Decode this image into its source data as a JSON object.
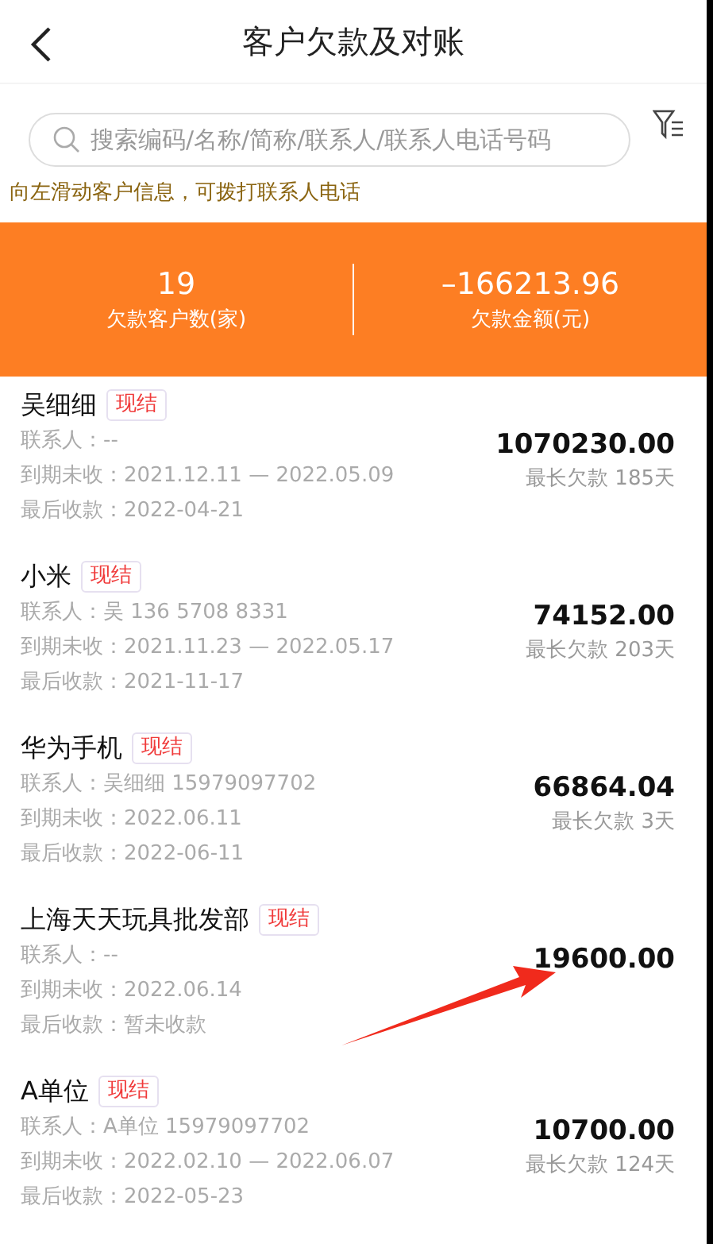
{
  "header": {
    "title": "客户欠款及对账"
  },
  "search": {
    "placeholder": "搜索编码/名称/简称/联系人/联系人电话号码"
  },
  "hint": "向左滑动客户信息，可拨打联系人电话",
  "summary": [
    {
      "value": "19",
      "label": "欠款客户数(家)"
    },
    {
      "value": "–166213.96",
      "label": "欠款金额(元)"
    }
  ],
  "customers": [
    {
      "name": "吴细细",
      "tag": "现结",
      "contact": "联系人：--",
      "due": "到期未收：2021.12.11 — 2022.05.09",
      "last": "最后收款：2022-04-21",
      "amount": "1070230.00",
      "longest": "最长欠款 185天"
    },
    {
      "name": "小米",
      "tag": "现结",
      "contact": "联系人：吴 136 5708 8331",
      "due": "到期未收：2021.11.23 — 2022.05.17",
      "last": "最后收款：2021-11-17",
      "amount": "74152.00",
      "longest": "最长欠款 203天"
    },
    {
      "name": "华为手机",
      "tag": "现结",
      "contact": "联系人：吴细细 15979097702",
      "due": "到期未收：2022.06.11",
      "last": "最后收款：2022-06-11",
      "amount": "66864.04",
      "longest": "最长欠款 3天"
    },
    {
      "name": "上海天天玩具批发部",
      "tag": "现结",
      "contact": "联系人：--",
      "due": "到期未收：2022.06.14",
      "last": "最后收款：暂未收款",
      "amount": "19600.00"
    },
    {
      "name": "A单位",
      "tag": "现结",
      "contact": "联系人：A单位 15979097702",
      "due": "到期未收：2022.02.10 — 2022.06.07",
      "last": "最后收款：2022-05-23",
      "amount": "10700.00",
      "longest": "最长欠款 124天"
    }
  ]
}
